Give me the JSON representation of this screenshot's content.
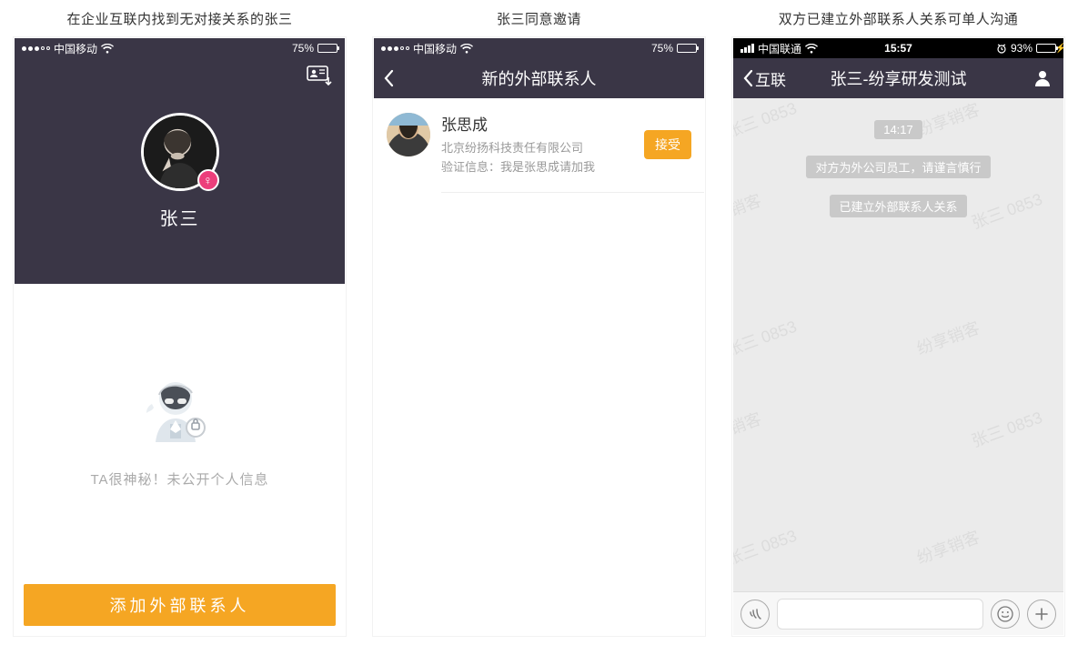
{
  "captions": {
    "c1": "在企业互联内找到无对接关系的张三",
    "c2": "张三同意邀请",
    "c3": "双方已建立外部联系人关系可单人沟通"
  },
  "status": {
    "carrier_a": "中国移动",
    "carrier_b": "中国联通",
    "battery_a": "75%",
    "battery_b": "93%",
    "time": "15:57"
  },
  "screen1": {
    "name": "张三",
    "secret_line": "TA很神秘！未公开个人信息",
    "add_btn": "添加外部联系人"
  },
  "screen2": {
    "title": "新的外部联系人",
    "req_name": "张思成",
    "req_company": "北京纷扬科技责任有限公司",
    "req_verify": "验证信息：我是张思成请加我",
    "accept": "接受"
  },
  "screen3": {
    "back_label": "互联",
    "title": "张三-纷享研发测试",
    "time_pill": "14:17",
    "sys1": "对方为外公司员工，请谨言慎行",
    "sys2": "已建立外部联系人关系",
    "wm_a": "张三 0853",
    "wm_b": "纷享销客"
  }
}
